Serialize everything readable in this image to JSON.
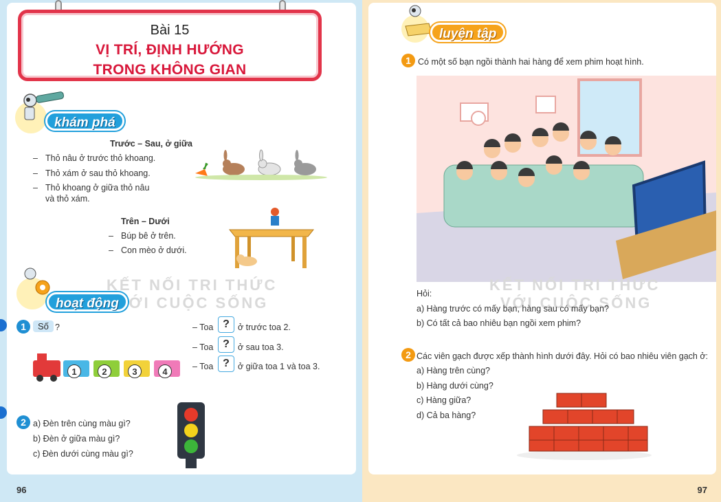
{
  "left_page": {
    "page_number": "96",
    "lesson": "Bài 15",
    "title_line1": "VỊ TRÍ, ĐỊNH HƯỚNG",
    "title_line2": "TRONG KHÔNG GIAN",
    "kham_pha": {
      "badge": "khám phá",
      "heading1": "Trước – Sau, ở giữa",
      "items1": [
        "Thỏ nâu ở trước thỏ khoang.",
        "Thỏ xám ở sau thỏ khoang.",
        "Thỏ khoang ở giữa thỏ nâu",
        "và thỏ xám."
      ],
      "heading2": "Trên – Dưới",
      "items2": [
        "Búp bê ở trên.",
        "Con mèo ở dưới."
      ]
    },
    "watermark1": "KẾT NỐI TRI THỨC",
    "watermark2": "VỚI CUỘC SỐNG",
    "hoat_dong": {
      "badge": "hoạt động",
      "ex1": {
        "number": "1",
        "label": "Số",
        "suffix": "?",
        "q_mark": "?",
        "lines": [
          {
            "pre": "– Toa",
            "post": "ở trước toa 2."
          },
          {
            "pre": "– Toa",
            "post": "ở sau toa 3."
          },
          {
            "pre": "– Toa",
            "post": "ở giữa toa 1 và toa 3."
          }
        ],
        "cars": [
          "1",
          "2",
          "3",
          "4"
        ]
      },
      "ex2": {
        "number": "2",
        "items": [
          "a) Đèn trên cùng màu gì?",
          "b) Đèn ở giữa màu gì?",
          "c) Đèn dưới cùng màu gì?"
        ]
      }
    }
  },
  "right_page": {
    "page_number": "97",
    "luyen_tap": {
      "badge": "luyện tập"
    },
    "ex1": {
      "number": "1",
      "text": "Có một số bạn ngồi thành hai hàng để xem phim hoạt hình.",
      "question_label": "Hỏi:",
      "items": [
        "a)  Hàng trước có mấy bạn, hàng sau có mấy bạn?",
        "b)  Có tất cả bao nhiêu bạn ngồi xem phim?"
      ]
    },
    "watermark1": "KẾT NỐI TRI THỨC",
    "watermark2": "VỚI CUỘC SỐNG",
    "ex2": {
      "number": "2",
      "text": "Các viên gạch được xếp thành hình dưới đây. Hỏi có bao nhiêu viên gạch ở:",
      "items": [
        "a) Hàng trên cùng?",
        "b) Hàng dưới cùng?",
        "c) Hàng giữa?",
        "d) Cả ba hàng?"
      ]
    }
  },
  "colors": {
    "title_red": "#d8173a",
    "badge_blue": "#22a0dc",
    "badge_orange": "#f6a31b",
    "left_bg": "#cfe8f5",
    "right_bg": "#fbe7c2"
  }
}
